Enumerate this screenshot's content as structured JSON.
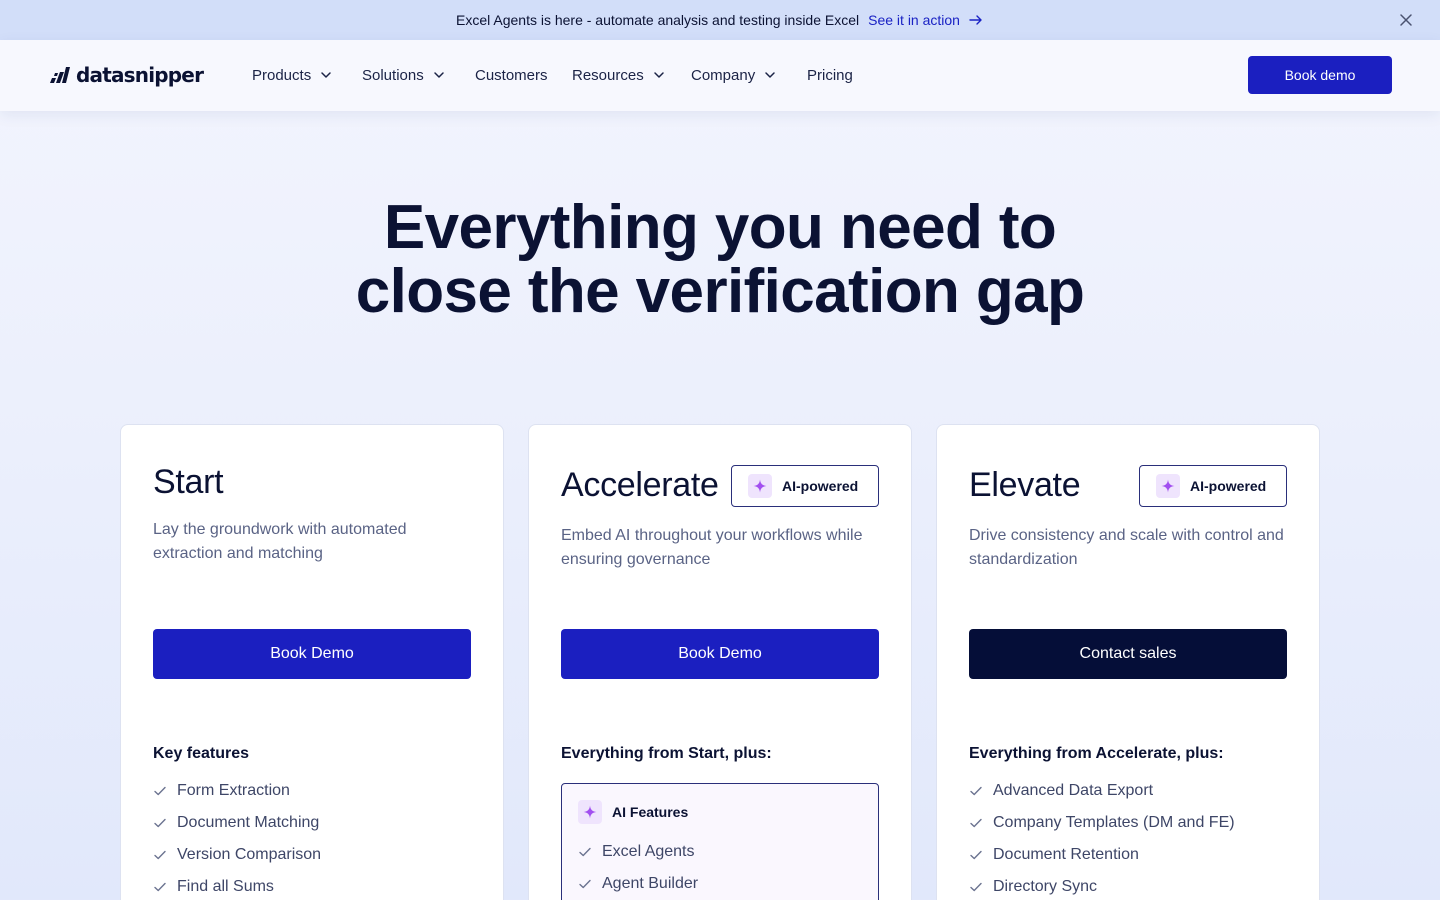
{
  "announcement": {
    "message": "Excel Agents is here - automate analysis and testing inside Excel",
    "cta": "See it in action"
  },
  "nav": {
    "logo": "datasnipper",
    "items": [
      {
        "label": "Products",
        "dropdown": true
      },
      {
        "label": "Solutions",
        "dropdown": true
      },
      {
        "label": "Customers",
        "dropdown": false
      },
      {
        "label": "Resources",
        "dropdown": true
      },
      {
        "label": "Company",
        "dropdown": true
      },
      {
        "label": "Pricing",
        "dropdown": false
      }
    ],
    "cta": "Book demo"
  },
  "hero": {
    "line1": "Everything you need to",
    "line2": "close the verification gap"
  },
  "plans": [
    {
      "title": "Start",
      "description": "Lay the groundwork with automated extraction and matching",
      "button": "Book Demo",
      "features_heading": "Key features",
      "features": [
        "Form Extraction",
        "Document Matching",
        "Version Comparison",
        "Find all Sums"
      ]
    },
    {
      "title": "Accelerate",
      "badge": "AI-powered",
      "description": "Embed AI throughout your workflows while ensuring governance",
      "button": "Book Demo",
      "features_heading": "Everything from Start, plus:",
      "ai_box_title": "AI Features",
      "features": [
        "Excel Agents",
        "Agent Builder"
      ]
    },
    {
      "title": "Elevate",
      "badge": "AI-powered",
      "description": "Drive consistency and scale with control and standardization",
      "button": "Contact sales",
      "features_heading": "Everything from Accelerate, plus:",
      "features": [
        "Advanced Data Export",
        "Company Templates (DM and FE)",
        "Document Retention",
        "Directory Sync"
      ]
    }
  ],
  "colors": {
    "primary": "#1b1fc0",
    "dark": "#050e38",
    "announcement_bg": "#d2def9",
    "ai_accent": "#a24ff0"
  }
}
